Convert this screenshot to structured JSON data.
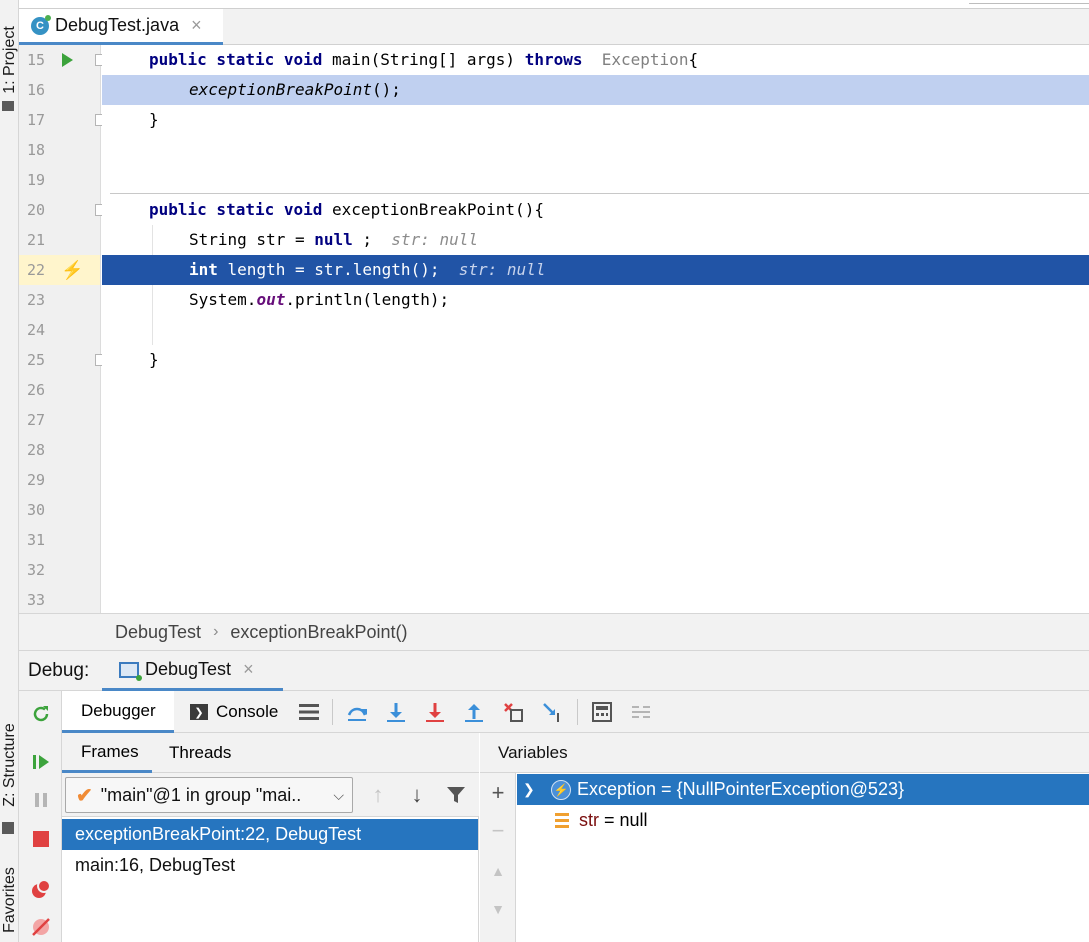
{
  "sidebar": {
    "project_tab": "1: Project",
    "structure_tab": "Z: Structure",
    "favorites_tab": "Favorites"
  },
  "editor": {
    "file_tab": "DebugTest.java",
    "file_icon_letter": "C",
    "close_glyph": "×",
    "lines": [
      {
        "num": "15"
      },
      {
        "num": "16"
      },
      {
        "num": "17"
      },
      {
        "num": "18"
      },
      {
        "num": "19"
      },
      {
        "num": "20"
      },
      {
        "num": "21"
      },
      {
        "num": "22"
      },
      {
        "num": "23"
      },
      {
        "num": "24"
      },
      {
        "num": "25"
      },
      {
        "num": "26"
      },
      {
        "num": "27"
      },
      {
        "num": "28"
      },
      {
        "num": "29"
      },
      {
        "num": "30"
      },
      {
        "num": "31"
      },
      {
        "num": "32"
      },
      {
        "num": "33"
      }
    ],
    "code": {
      "l15_a": "public static void ",
      "l15_b": "main(String[] args) ",
      "l15_c": "throws",
      "l15_d": "  Exception",
      "l15_e": "{",
      "l16": "exceptionBreakPoint",
      "l16_b": "();",
      "l17": "}",
      "l20_a": "public static void ",
      "l20_b": "exceptionBreakPoint(){",
      "l21_a": "String str = ",
      "l21_b": "null",
      "l21_c": " ;  ",
      "l21_hint": "str: null",
      "l22_a": "int",
      "l22_b": " length = str.length();  ",
      "l22_hint": "str: null",
      "l23_a": "System.",
      "l23_b": "out",
      "l23_c": ".println(length);",
      "l25": "}"
    },
    "colors": {
      "execution_line": "#2154a6",
      "frame_line": "#c0d0f0",
      "keyword": "#000080"
    }
  },
  "breadcrumb": {
    "class": "DebugTest",
    "separator": "›",
    "method": "exceptionBreakPoint()"
  },
  "debug": {
    "title": "Debug:",
    "session_tab": "DebugTest",
    "close_glyph": "×",
    "tabs": {
      "debugger": "Debugger",
      "console": "Console"
    },
    "frames_tabs": {
      "frames": "Frames",
      "threads": "Threads"
    },
    "thread_selector": "\"main\"@1 in group \"mai..",
    "frames": [
      {
        "label": "exceptionBreakPoint:22, DebugTest",
        "selected": true
      },
      {
        "label": "main:16, DebugTest",
        "selected": false
      }
    ],
    "variables_header": "Variables",
    "variables": [
      {
        "text": "Exception = {NullPointerException@523}",
        "selected": true,
        "icon": "exception-icon"
      },
      {
        "name": "str",
        "value": " = null",
        "selected": false,
        "icon": "field-icon"
      }
    ],
    "accent_color": "#2675bf"
  }
}
